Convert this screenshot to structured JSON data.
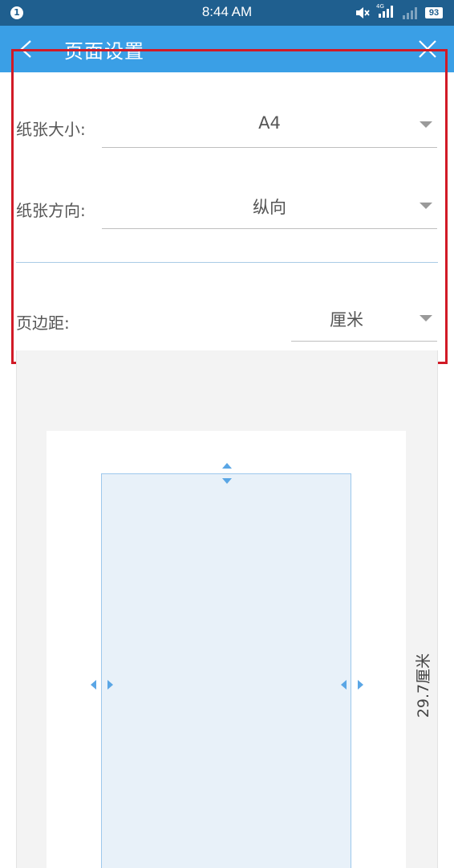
{
  "status_bar": {
    "notification_count": "1",
    "time": "8:44 AM",
    "network": "4G",
    "battery": "93"
  },
  "header": {
    "title": "页面设置"
  },
  "form": {
    "paper_size": {
      "label": "纸张大小:",
      "value": "A4"
    },
    "orientation": {
      "label": "纸张方向:",
      "value": "纵向"
    },
    "margins": {
      "label": "页边距:",
      "unit": "厘米"
    }
  },
  "preview": {
    "height_label": "29.7厘米"
  },
  "colors": {
    "status_bar": "#1f5f8f",
    "header": "#3a9fe6",
    "highlight": "#d11a26",
    "margin_handle": "#5aa6e5",
    "content_fill": "#e8f1f9"
  },
  "icons": [
    "back-arrow-icon",
    "close-icon",
    "mute-icon",
    "signal-icon",
    "battery-icon",
    "dropdown-arrow-icon",
    "margin-handle-icon"
  ]
}
